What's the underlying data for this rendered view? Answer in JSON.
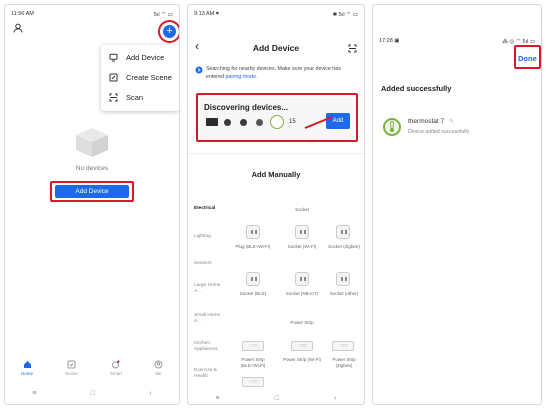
{
  "panel1": {
    "status_time": "11:56 AM",
    "status_icons": "5ıl ⌔ ▭",
    "plus_symbol": "+",
    "menu": [
      {
        "label": "Add Device",
        "icon": "add-device-icon"
      },
      {
        "label": "Create Scene",
        "icon": "create-scene-icon"
      },
      {
        "label": "Scan",
        "icon": "scan-icon"
      }
    ],
    "empty_text": "No devices",
    "add_device_button": "Add Device",
    "tabs": [
      {
        "label": "Home",
        "icon": "home-icon",
        "active": true
      },
      {
        "label": "Scene",
        "icon": "scene-icon"
      },
      {
        "label": "Smart",
        "icon": "smart-icon"
      },
      {
        "label": "Me",
        "icon": "me-icon"
      }
    ],
    "nav": [
      "≡",
      "□",
      "‹"
    ]
  },
  "panel2": {
    "status_time": "9:13 AM ♥",
    "status_icons": "✱ 5ıl ⌔ ▭",
    "back": "‹",
    "title": "Add Device",
    "searching_text": "Searching for nearby devices. Make sure your device has entered",
    "pairing_link": "pairing mode.",
    "discovering": "Discovering devices...",
    "device_count": "15",
    "add_button": "Add",
    "add_manually": "Add Manually",
    "categories": [
      "Electrical",
      "Lighting",
      "Sensors",
      "Large Home A...",
      "Small Home A...",
      "Kitchen Appliances",
      "Exercise & Health"
    ],
    "col_header_socket": "Socket",
    "row1": [
      {
        "label": "Plug (BLE+Wi-Fi)"
      },
      {
        "label": "Socket (Wi-Fi)"
      },
      {
        "label": "Socket (Zigbee)"
      }
    ],
    "row2": [
      {
        "label": "Socket (BLE)"
      },
      {
        "label": "Socket (NB-IoT)"
      },
      {
        "label": "Socket (other)"
      }
    ],
    "col_header_strip": "Power Strip",
    "row3": [
      {
        "label": "Power Strip (BLE+Wi-Fi)"
      },
      {
        "label": "Power Strip (Wi-Fi)"
      },
      {
        "label": "Power Strip (Zigbee)"
      }
    ],
    "nav": [
      "≡",
      "□",
      "‹"
    ]
  },
  "panel3": {
    "status_time": "17:28 ▣",
    "status_icons": "⁂ ◎ ⌔ 5ıl ▭",
    "done": "Done",
    "added_title": "Added successfully",
    "device_name": "thermostat 7",
    "device_status": "Device added successfully"
  },
  "colors": {
    "accent": "#1e6ae6",
    "highlight": "#d7192a",
    "success": "#7cb342"
  }
}
